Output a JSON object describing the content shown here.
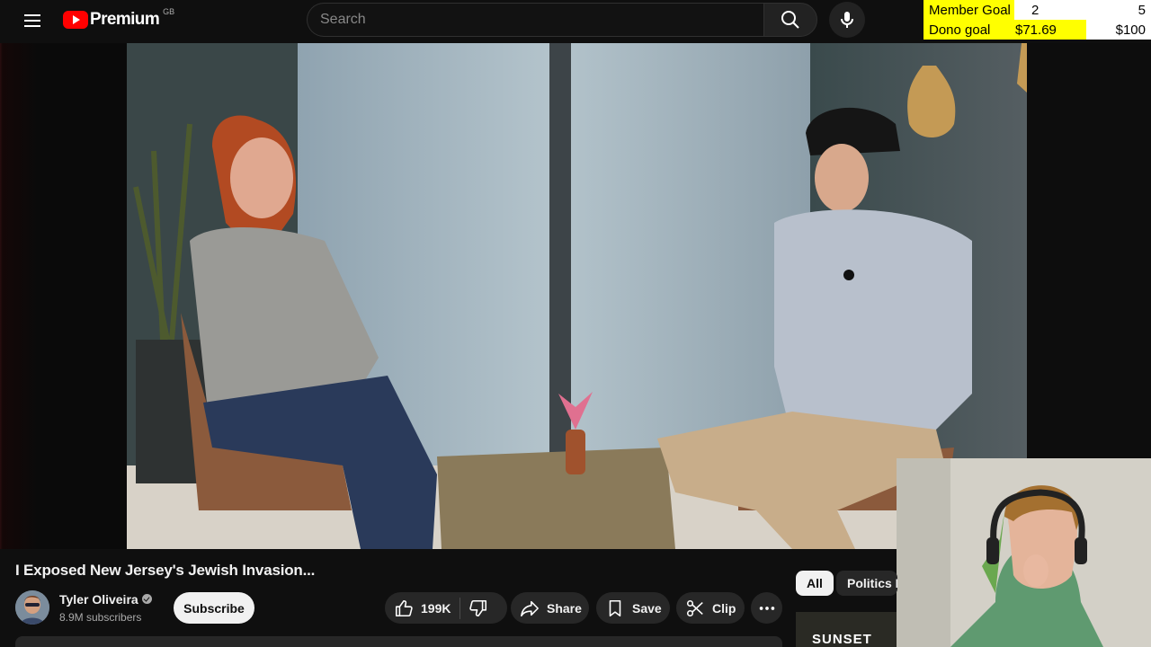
{
  "header": {
    "brand": "Premium",
    "region": "GB",
    "search_placeholder": "Search"
  },
  "goals": {
    "member": {
      "label": "Member Goal",
      "current": "2",
      "target": "5",
      "progress": 0.4
    },
    "dono": {
      "label": "Dono goal",
      "current": "$71.69",
      "target": "$100",
      "progress": 0.7169
    }
  },
  "video": {
    "title": "I Exposed New Jersey's Jewish Invasion..."
  },
  "channel": {
    "name": "Tyler Oliveira",
    "subscribers": "8.9M subscribers",
    "subscribe_label": "Subscribe"
  },
  "actions": {
    "likes": "199K",
    "share": "Share",
    "save": "Save",
    "clip": "Clip"
  },
  "chips": {
    "all": "All",
    "politics": "Politics N"
  },
  "recommended": {
    "thumb_text": "SUNSET"
  },
  "colors": {
    "brand_red": "#ff0000",
    "goal_yellow": "#ffff00"
  }
}
